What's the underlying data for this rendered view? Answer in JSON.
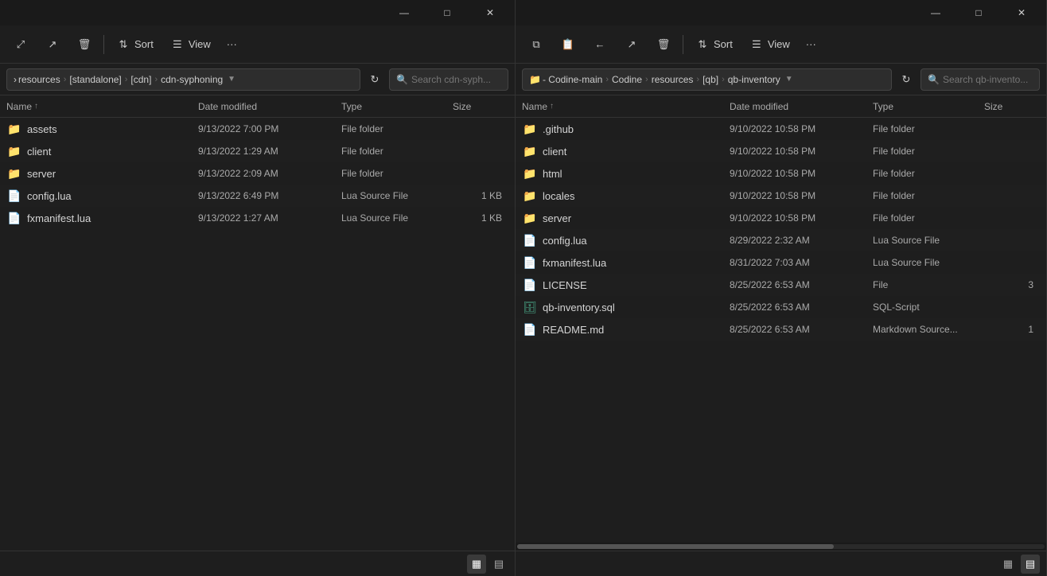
{
  "left_pane": {
    "title_bar": {
      "minimize": "—",
      "maximize": "□",
      "close": "✕"
    },
    "toolbar": {
      "expand_icon": "⤢",
      "share_icon": "↗",
      "delete_icon": "🗑",
      "sort_label": "Sort",
      "view_label": "View",
      "more_icon": "···"
    },
    "address": {
      "parts": [
        "resources",
        "[standalone]",
        "[cdn]",
        "cdn-syphoning"
      ],
      "search_placeholder": "Search cdn-syph..."
    },
    "columns": {
      "name": "Name",
      "date_modified": "Date modified",
      "type": "Type",
      "size": "Size"
    },
    "files": [
      {
        "icon": "folder",
        "name": "assets",
        "date": "9/13/2022 7:00 PM",
        "type": "File folder",
        "size": ""
      },
      {
        "icon": "folder",
        "name": "client",
        "date": "9/13/2022 1:29 AM",
        "type": "File folder",
        "size": ""
      },
      {
        "icon": "folder",
        "name": "server",
        "date": "9/13/2022 2:09 AM",
        "type": "File folder",
        "size": ""
      },
      {
        "icon": "lua",
        "name": "config.lua",
        "date": "9/13/2022 6:49 PM",
        "type": "Lua Source File",
        "size": "1 KB"
      },
      {
        "icon": "lua",
        "name": "fxmanifest.lua",
        "date": "9/13/2022 1:27 AM",
        "type": "Lua Source File",
        "size": "1 KB"
      }
    ]
  },
  "right_pane": {
    "title_bar": {
      "minimize": "—",
      "maximize": "□",
      "close": "✕"
    },
    "toolbar": {
      "copy_icon": "⧉",
      "paste_icon": "📋",
      "back_icon": "←",
      "share_icon": "↗",
      "delete_icon": "🗑",
      "sort_label": "Sort",
      "view_label": "View",
      "more_icon": "···"
    },
    "address": {
      "prefix": "- Codine-main",
      "parts": [
        "Codine",
        "resources",
        "[qb]",
        "qb-inventory"
      ],
      "search_placeholder": "Search qb-invento..."
    },
    "columns": {
      "name": "Name",
      "date_modified": "Date modified",
      "type": "Type",
      "size": "Size"
    },
    "files": [
      {
        "icon": "folder",
        "name": ".github",
        "date": "9/10/2022 10:58 PM",
        "type": "File folder",
        "size": ""
      },
      {
        "icon": "folder",
        "name": "client",
        "date": "9/10/2022 10:58 PM",
        "type": "File folder",
        "size": ""
      },
      {
        "icon": "folder",
        "name": "html",
        "date": "9/10/2022 10:58 PM",
        "type": "File folder",
        "size": ""
      },
      {
        "icon": "folder",
        "name": "locales",
        "date": "9/10/2022 10:58 PM",
        "type": "File folder",
        "size": ""
      },
      {
        "icon": "folder",
        "name": "server",
        "date": "9/10/2022 10:58 PM",
        "type": "File folder",
        "size": ""
      },
      {
        "icon": "lua",
        "name": "config.lua",
        "date": "8/29/2022 2:32 AM",
        "type": "Lua Source File",
        "size": ""
      },
      {
        "icon": "lua",
        "name": "fxmanifest.lua",
        "date": "8/31/2022 7:03 AM",
        "type": "Lua Source File",
        "size": ""
      },
      {
        "icon": "file",
        "name": "LICENSE",
        "date": "8/25/2022 6:53 AM",
        "type": "File",
        "size": "3"
      },
      {
        "icon": "sql",
        "name": "qb-inventory.sql",
        "date": "8/25/2022 6:53 AM",
        "type": "SQL-Script",
        "size": ""
      },
      {
        "icon": "file",
        "name": "README.md",
        "date": "8/25/2022 6:53 AM",
        "type": "Markdown Source...",
        "size": "1"
      }
    ]
  }
}
